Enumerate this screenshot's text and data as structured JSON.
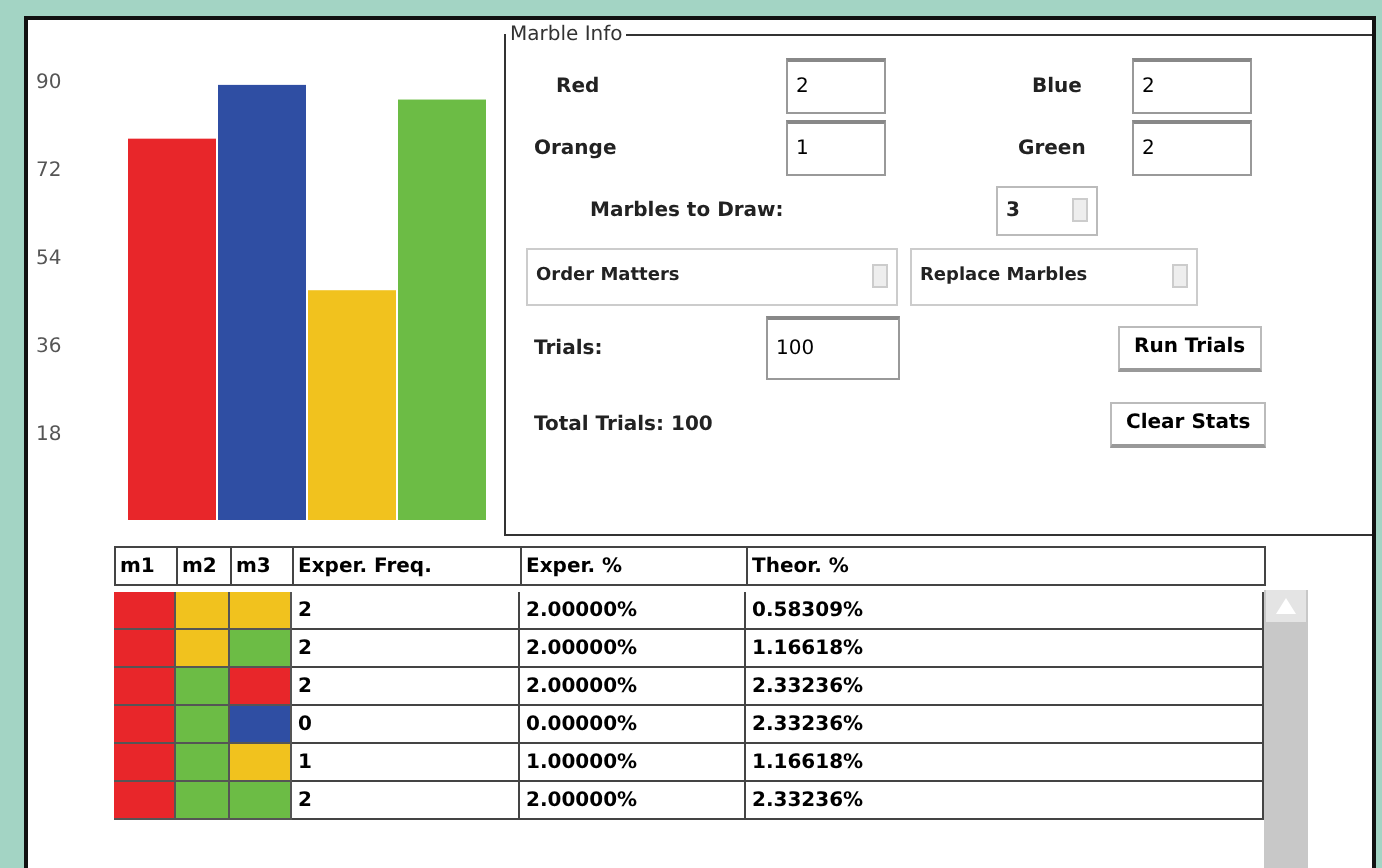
{
  "chart": {
    "chart_data": {
      "type": "bar",
      "values": [
        78,
        89,
        47,
        86
      ],
      "colors": [
        "#e8262a",
        "#2f4ea3",
        "#f1c21e",
        "#6cbc45"
      ],
      "yticks": [
        18,
        36,
        54,
        72,
        90
      ],
      "ylim": [
        0,
        90
      ]
    }
  },
  "marble_info": {
    "title": "Marble Info",
    "counts": [
      {
        "label": "Red",
        "value": "2"
      },
      {
        "label": "Blue",
        "value": "2"
      },
      {
        "label": "Orange",
        "value": "1"
      },
      {
        "label": "Green",
        "value": "2"
      }
    ],
    "marbles_to_draw": {
      "label": "Marbles to Draw:",
      "value": "3"
    },
    "dropdowns": [
      "Order Matters",
      "Replace Marbles"
    ],
    "trials": {
      "label": "Trials:",
      "value": "100"
    },
    "total_trials": "Total Trials: 100",
    "buttons": [
      "Run Trials",
      "Clear Stats"
    ]
  },
  "table": {
    "columns": [
      "m1",
      "m2",
      "m3",
      "Exper. Freq.",
      "Exper. %",
      "Theor. %"
    ],
    "rows": [
      {
        "marbles": [
          {
            "color": "#e8262a"
          },
          {
            "color": "#f1c21e"
          },
          {
            "color": "#f1c21e"
          }
        ],
        "cells": [
          "2",
          "2.00000%",
          "0.58309%"
        ]
      },
      {
        "marbles": [
          {
            "color": "#e8262a"
          },
          {
            "color": "#f1c21e"
          },
          {
            "color": "#6cbc45"
          }
        ],
        "cells": [
          "2",
          "2.00000%",
          "1.16618%"
        ]
      },
      {
        "marbles": [
          {
            "color": "#e8262a"
          },
          {
            "color": "#6cbc45"
          },
          {
            "color": "#e8262a"
          }
        ],
        "cells": [
          "2",
          "2.00000%",
          "2.33236%"
        ]
      },
      {
        "marbles": [
          {
            "color": "#e8262a"
          },
          {
            "color": "#6cbc45"
          },
          {
            "color": "#2f4ea3"
          }
        ],
        "cells": [
          "0",
          "0.00000%",
          "2.33236%"
        ]
      },
      {
        "marbles": [
          {
            "color": "#e8262a"
          },
          {
            "color": "#6cbc45"
          },
          {
            "color": "#f1c21e"
          }
        ],
        "cells": [
          "1",
          "1.00000%",
          "1.16618%"
        ]
      },
      {
        "marbles": [
          {
            "color": "#e8262a"
          },
          {
            "color": "#6cbc45"
          },
          {
            "color": "#6cbc45"
          }
        ],
        "cells": [
          "2",
          "2.00000%",
          "2.33236%"
        ]
      }
    ]
  }
}
